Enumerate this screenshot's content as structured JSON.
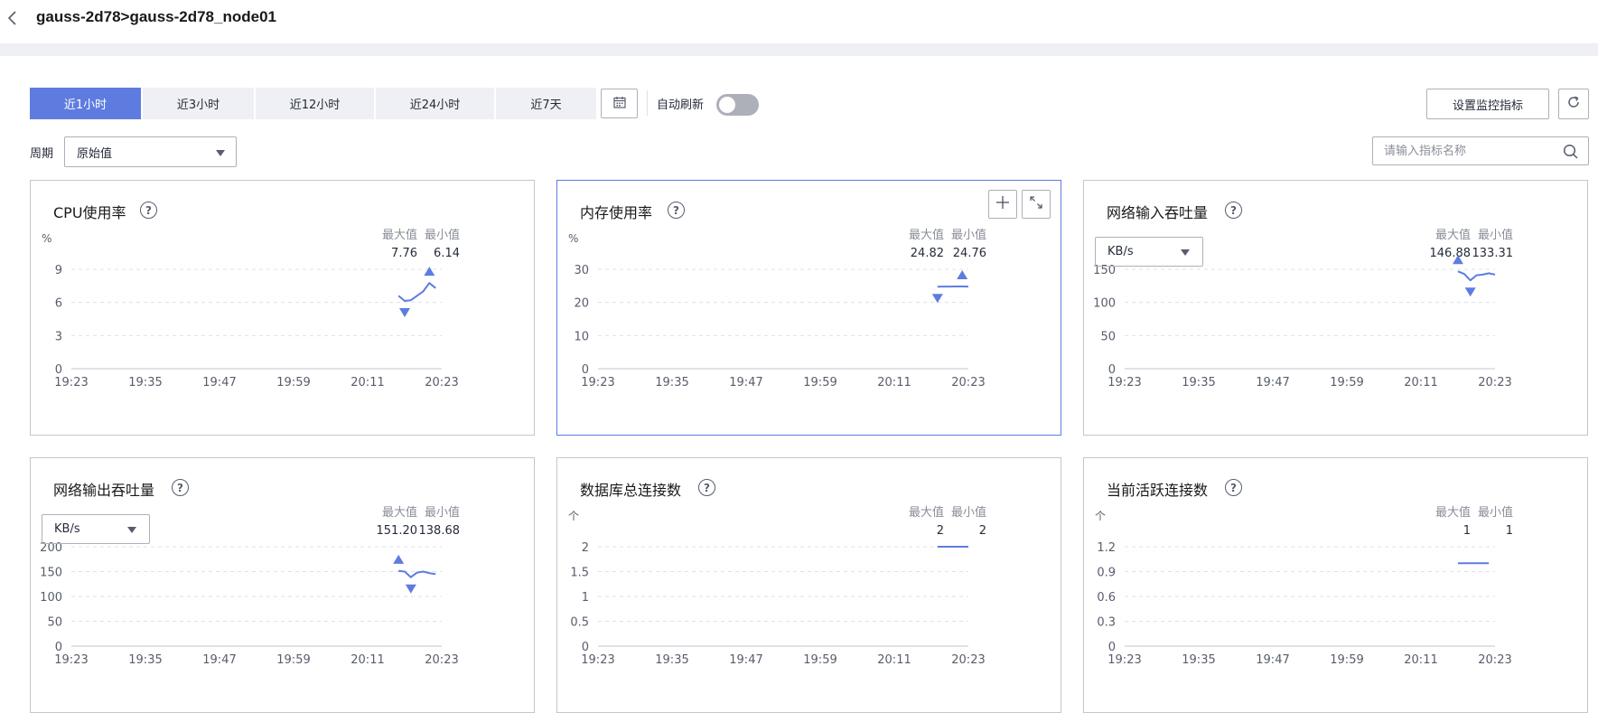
{
  "header": {
    "breadcrumb": "gauss-2d78>gauss-2d78_node01"
  },
  "toolbar": {
    "tabs": [
      {
        "label": "近1小时",
        "active": true
      },
      {
        "label": "近3小时",
        "active": false
      },
      {
        "label": "近12小时",
        "active": false
      },
      {
        "label": "近24小时",
        "active": false
      },
      {
        "label": "近7天",
        "active": false
      }
    ],
    "auto_refresh_label": "自动刷新",
    "auto_refresh_on": false,
    "settings_button": "设置监控指标",
    "period_label": "周期",
    "period_value": "原始值",
    "search_placeholder": "请输入指标名称"
  },
  "colors": {
    "accent": "#5e7ce0",
    "tab_bg": "#eef0f5",
    "grid": "#dfe1e6",
    "axis_text": "#575d6c"
  },
  "max_label": "最大值",
  "min_label": "最小值",
  "cards": [
    {
      "title": "CPU使用率",
      "unit": "%",
      "unit_select": null,
      "max": "7.76",
      "min": "6.14",
      "highlighted": false
    },
    {
      "title": "内存使用率",
      "unit": "%",
      "unit_select": null,
      "max": "24.82",
      "min": "24.76",
      "highlighted": true
    },
    {
      "title": "网络输入吞吐量",
      "unit": "",
      "unit_select": "KB/s",
      "max": "146.88",
      "min": "133.31",
      "highlighted": false
    },
    {
      "title": "网络输出吞吐量",
      "unit": "",
      "unit_select": "KB/s",
      "max": "151.20",
      "min": "138.68",
      "highlighted": false
    },
    {
      "title": "数据库总连接数",
      "unit": "个",
      "unit_select": null,
      "max": "2",
      "min": "2",
      "highlighted": false
    },
    {
      "title": "当前活跃连接数",
      "unit": "个",
      "unit_select": null,
      "max": "1",
      "min": "1",
      "highlighted": false
    }
  ],
  "chart_data": [
    {
      "type": "line",
      "title": "CPU使用率",
      "ylabel": "%",
      "x_ticks": [
        "19:23",
        "19:35",
        "19:47",
        "19:59",
        "20:11",
        "20:23"
      ],
      "y_ticks": [
        "0",
        "3",
        "6",
        "9"
      ],
      "ylim": [
        0,
        9
      ],
      "series": [
        {
          "x": [
            "20:16",
            "20:17",
            "20:18",
            "20:19",
            "20:20",
            "20:21",
            "20:22"
          ],
          "values": [
            6.6,
            6.14,
            6.2,
            6.6,
            7.0,
            7.76,
            7.3
          ]
        }
      ],
      "max_point": {
        "x": "20:21",
        "y": 7.76
      },
      "min_point": {
        "x": "20:17",
        "y": 6.14
      }
    },
    {
      "type": "line",
      "title": "内存使用率",
      "ylabel": "%",
      "x_ticks": [
        "19:23",
        "19:35",
        "19:47",
        "19:59",
        "20:11",
        "20:23"
      ],
      "y_ticks": [
        "0",
        "10",
        "20",
        "30"
      ],
      "ylim": [
        0,
        30
      ],
      "series": [
        {
          "x": [
            "20:18",
            "20:19",
            "20:20",
            "20:21",
            "20:22",
            "20:23"
          ],
          "values": [
            24.76,
            24.78,
            24.8,
            24.82,
            24.82,
            24.8
          ]
        }
      ],
      "max_point": {
        "x": "20:22",
        "y": 24.82
      },
      "min_point": {
        "x": "20:18",
        "y": 24.76
      }
    },
    {
      "type": "line",
      "title": "网络输入吞吐量",
      "ylabel": "",
      "x_ticks": [
        "19:23",
        "19:35",
        "19:47",
        "19:59",
        "20:11",
        "20:23"
      ],
      "y_ticks": [
        "0",
        "50",
        "100",
        "150"
      ],
      "ylim": [
        0,
        150
      ],
      "series": [
        {
          "x": [
            "20:17",
            "20:18",
            "20:19",
            "20:20",
            "20:21",
            "20:22",
            "20:23"
          ],
          "values": [
            146.88,
            143,
            133.31,
            141,
            142,
            144,
            142
          ]
        }
      ],
      "max_point": {
        "x": "20:17",
        "y": 146.88
      },
      "min_point": {
        "x": "20:19",
        "y": 133.31
      }
    },
    {
      "type": "line",
      "title": "网络输出吞吐量",
      "ylabel": "",
      "x_ticks": [
        "19:23",
        "19:35",
        "19:47",
        "19:59",
        "20:11",
        "20:23"
      ],
      "y_ticks": [
        "0",
        "50",
        "100",
        "150",
        "200"
      ],
      "ylim": [
        0,
        200
      ],
      "series": [
        {
          "x": [
            "20:16",
            "20:17",
            "20:18",
            "20:19",
            "20:20",
            "20:21",
            "20:22"
          ],
          "values": [
            151.2,
            150,
            138.68,
            148,
            150,
            147,
            145
          ]
        }
      ],
      "max_point": {
        "x": "20:16",
        "y": 151.2
      },
      "min_point": {
        "x": "20:18",
        "y": 138.68
      }
    },
    {
      "type": "line",
      "title": "数据库总连接数",
      "ylabel": "个",
      "x_ticks": [
        "19:23",
        "19:35",
        "19:47",
        "19:59",
        "20:11",
        "20:23"
      ],
      "y_ticks": [
        "0",
        "0.5",
        "1",
        "1.5",
        "2"
      ],
      "ylim": [
        0,
        2
      ],
      "series": [
        {
          "x": [
            "20:18",
            "20:19",
            "20:20",
            "20:21",
            "20:22",
            "20:23"
          ],
          "values": [
            2,
            2,
            2,
            2,
            2,
            2
          ]
        }
      ],
      "max_point": null,
      "min_point": null
    },
    {
      "type": "line",
      "title": "当前活跃连接数",
      "ylabel": "个",
      "x_ticks": [
        "19:23",
        "19:35",
        "19:47",
        "19:59",
        "20:11",
        "20:23"
      ],
      "y_ticks": [
        "0",
        "0.3",
        "0.6",
        "0.9",
        "1.2"
      ],
      "ylim": [
        0,
        1.2
      ],
      "series": [
        {
          "x": [
            "20:17",
            "20:18",
            "20:19",
            "20:20",
            "20:21",
            "20:22"
          ],
          "values": [
            1,
            1,
            1,
            1,
            1,
            1
          ]
        }
      ],
      "max_point": null,
      "min_point": null
    }
  ]
}
